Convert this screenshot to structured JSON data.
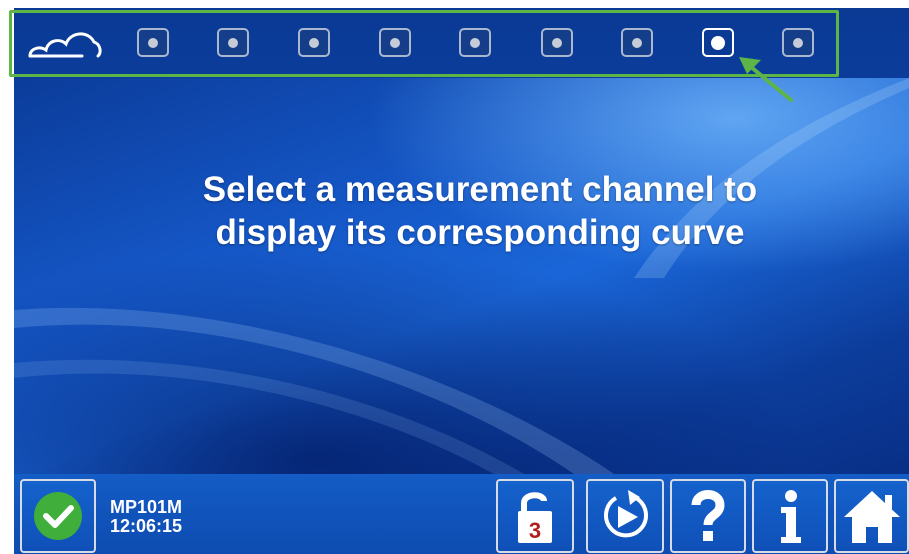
{
  "topbar": {
    "logo_icon": "cloud-logo-icon",
    "channels": [
      {
        "id": "channel-1",
        "selected": false
      },
      {
        "id": "channel-2",
        "selected": false
      },
      {
        "id": "channel-3",
        "selected": false
      },
      {
        "id": "channel-4",
        "selected": false
      },
      {
        "id": "channel-5",
        "selected": false
      },
      {
        "id": "channel-6",
        "selected": false
      },
      {
        "id": "channel-7",
        "selected": false
      },
      {
        "id": "channel-8",
        "selected": true
      },
      {
        "id": "channel-9",
        "selected": false
      }
    ],
    "highlight_color": "#5cb546"
  },
  "main": {
    "message_line1": "Select a measurement channel to",
    "message_line2": "display its corresponding curve"
  },
  "bottombar": {
    "status_icon": "checkmark-icon",
    "device_name": "MP101M",
    "time": "12:06:15",
    "lock_badge": "3",
    "buttons": [
      "unlock-icon",
      "replay-icon",
      "help-icon",
      "info-icon",
      "home-icon"
    ]
  },
  "colors": {
    "background": "#0a3f9e",
    "accent_green": "#5cb546",
    "text": "#ffffff"
  }
}
